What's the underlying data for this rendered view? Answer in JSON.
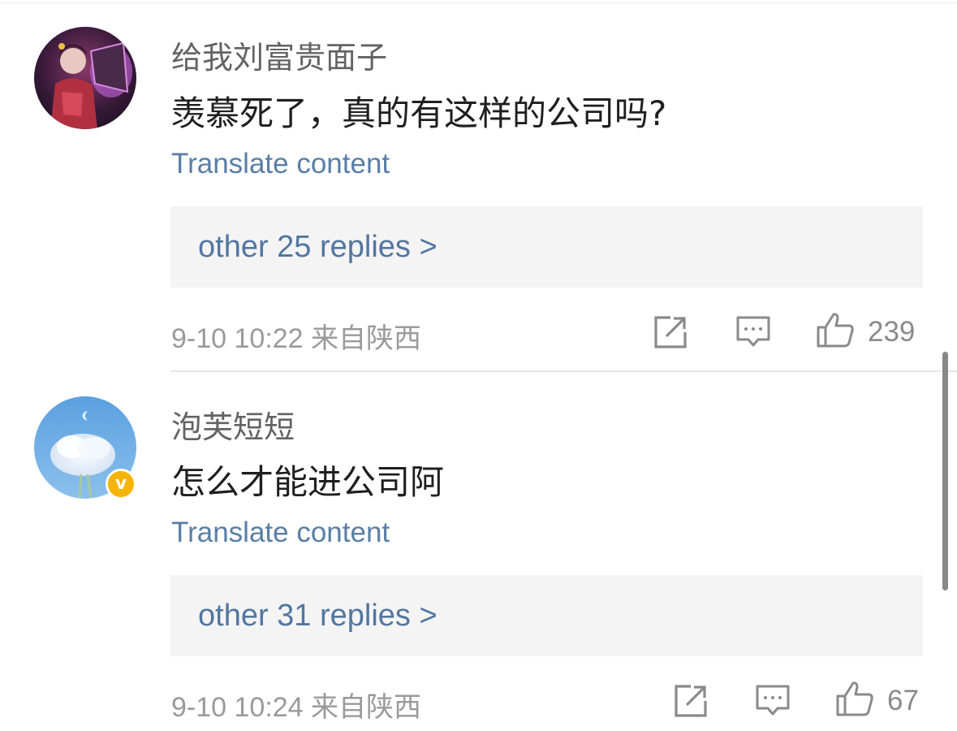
{
  "comments": [
    {
      "username": "给我刘富贵面子",
      "text": "羡慕死了，真的有这样的公司吗?",
      "translate_label": "Translate content",
      "replies_label": "other 25 replies >",
      "meta": "9-10 10:22 来自陕西",
      "like_count": "239",
      "verified": false
    },
    {
      "username": "泡芙短短",
      "text": "怎么才能进公司阿",
      "translate_label": "Translate content",
      "replies_label": "other 31 replies >",
      "meta": "9-10 10:24 来自陕西",
      "like_count": "67",
      "verified": true,
      "verified_mark": "v"
    }
  ],
  "icons": {
    "share": "share-icon",
    "comment": "comment-icon",
    "like": "thumbs-up-icon"
  },
  "colors": {
    "link": "#5276a1",
    "verified_badge": "#f4b400",
    "reply_box_bg": "#f4f4f4"
  }
}
